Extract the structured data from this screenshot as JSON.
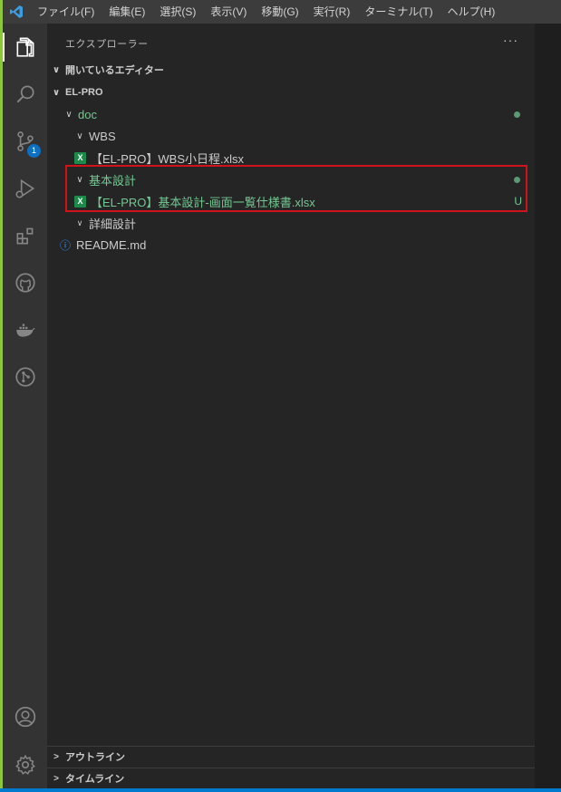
{
  "menubar": {
    "items": [
      "ファイル(F)",
      "編集(E)",
      "選択(S)",
      "表示(V)",
      "移動(G)",
      "実行(R)",
      "ターミナル(T)",
      "ヘルプ(H)"
    ]
  },
  "activitybar": {
    "icons": [
      "explorer-icon",
      "search-icon",
      "source-control-icon",
      "run-debug-icon",
      "extensions-icon",
      "github-icon",
      "docker-icon",
      "git-graph-icon",
      "account-icon",
      "settings-gear-icon"
    ],
    "scm_badge": "1"
  },
  "sidebar": {
    "title": "エクスプローラー",
    "more": "···",
    "open_editors": "開いているエディター",
    "root": "EL-PRO",
    "tree": {
      "doc": "doc",
      "wbs": "WBS",
      "wbs_file": "【EL-PRO】WBS小日程.xlsx",
      "kihon": "基本設計",
      "kihon_file": "【EL-PRO】基本設計-画面一覧仕様書.xlsx",
      "kihon_file_status": "U",
      "shosai": "詳細設計",
      "readme": "README.md"
    },
    "outline": "アウトライン",
    "timeline": "タイムライン"
  },
  "colors": {
    "accent_green": "#73c991",
    "highlight_red": "#d0121b",
    "badge_blue": "#0e70c0"
  }
}
